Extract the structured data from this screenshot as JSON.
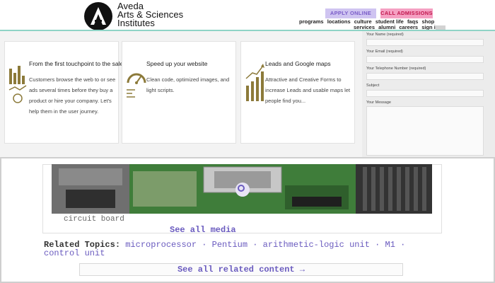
{
  "header": {
    "logo_lines": [
      "Aveda",
      "Arts & Sciences",
      "Institutes"
    ],
    "apply_label": "APPLY ONLINE",
    "call_label": "CALL ADMISSIONS",
    "nav_row1": [
      "programs",
      "locations",
      "culture",
      "student life",
      "faqs",
      "shop"
    ],
    "nav_row2": [
      "services",
      "alumni",
      "careers",
      "sign in"
    ]
  },
  "features": [
    {
      "title": "From the first touchpoint to the sale",
      "text": "Customers browse the web to or see ads several times before they buy a product or hire your company. Let's help them in the user journey.",
      "icon": "analytics-chart-icon"
    },
    {
      "title": "Speed up your website",
      "text": "Clean code, optimized images, and light scripts.",
      "icon": "speedometer-icon"
    },
    {
      "title": "Leads and Google maps",
      "text": "Attractive and Creative Forms to increase Leads and usable maps let people find you...",
      "icon": "growth-chart-icon"
    }
  ],
  "contact_form": {
    "name_label": "Your Name (required)",
    "email_label": "Your Email (required)",
    "phone_label": "Your Telephone Number (required)",
    "subject_label": "Subject",
    "message_label": "Your Message"
  },
  "media": {
    "caption": "circuit board",
    "see_all_media": "See all media",
    "related_label": "Related Topics:",
    "related_topics": "microprocessor · Pentium · arithmetic-logic unit · M1 · control unit",
    "see_all_related": "See all related content →"
  },
  "colors": {
    "accent_teal": "#8fd3c6",
    "apply_bg": "#cfc4f1",
    "call_bg": "#f5a0c2",
    "link_purple": "#6a5bbf"
  }
}
